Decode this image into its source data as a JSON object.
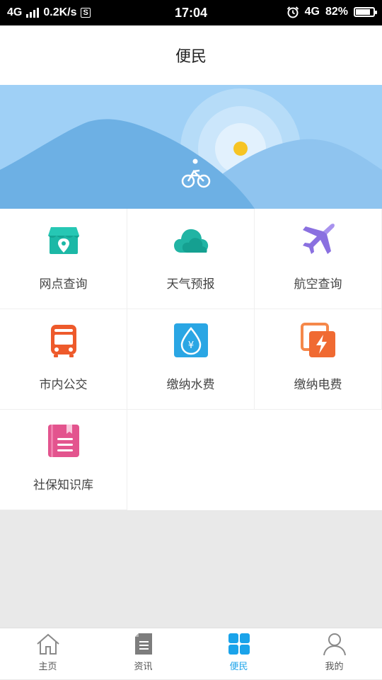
{
  "status_bar": {
    "network": "4G",
    "speed": "0.2K/s",
    "s_badge": "S",
    "time": "17:04",
    "network_right": "4G",
    "battery": "82%",
    "battery_level": 0.82
  },
  "header": {
    "title": "便民"
  },
  "grid": {
    "items": [
      {
        "label": "网点查询",
        "icon": "store-location-icon",
        "color": "#1cb8a6"
      },
      {
        "label": "天气预报",
        "icon": "cloud-icon",
        "color": "#21b4a4"
      },
      {
        "label": "航空查询",
        "icon": "airplane-icon",
        "color": "#8a70e0"
      },
      {
        "label": "市内公交",
        "icon": "bus-icon",
        "color": "#ee5a2b"
      },
      {
        "label": "缴纳水费",
        "icon": "water-drop-icon",
        "color": "#2aa6e4"
      },
      {
        "label": "缴纳电费",
        "icon": "electric-bolt-icon",
        "color": "#f06a32"
      },
      {
        "label": "社保知识库",
        "icon": "book-icon",
        "color": "#e3548e"
      }
    ]
  },
  "bottom_nav": {
    "items": [
      {
        "label": "主页",
        "icon": "home-icon"
      },
      {
        "label": "资讯",
        "icon": "document-icon"
      },
      {
        "label": "便民",
        "icon": "grid-icon"
      },
      {
        "label": "我的",
        "icon": "person-icon"
      }
    ],
    "active": "便民",
    "active_color": "#1aa3ea"
  }
}
